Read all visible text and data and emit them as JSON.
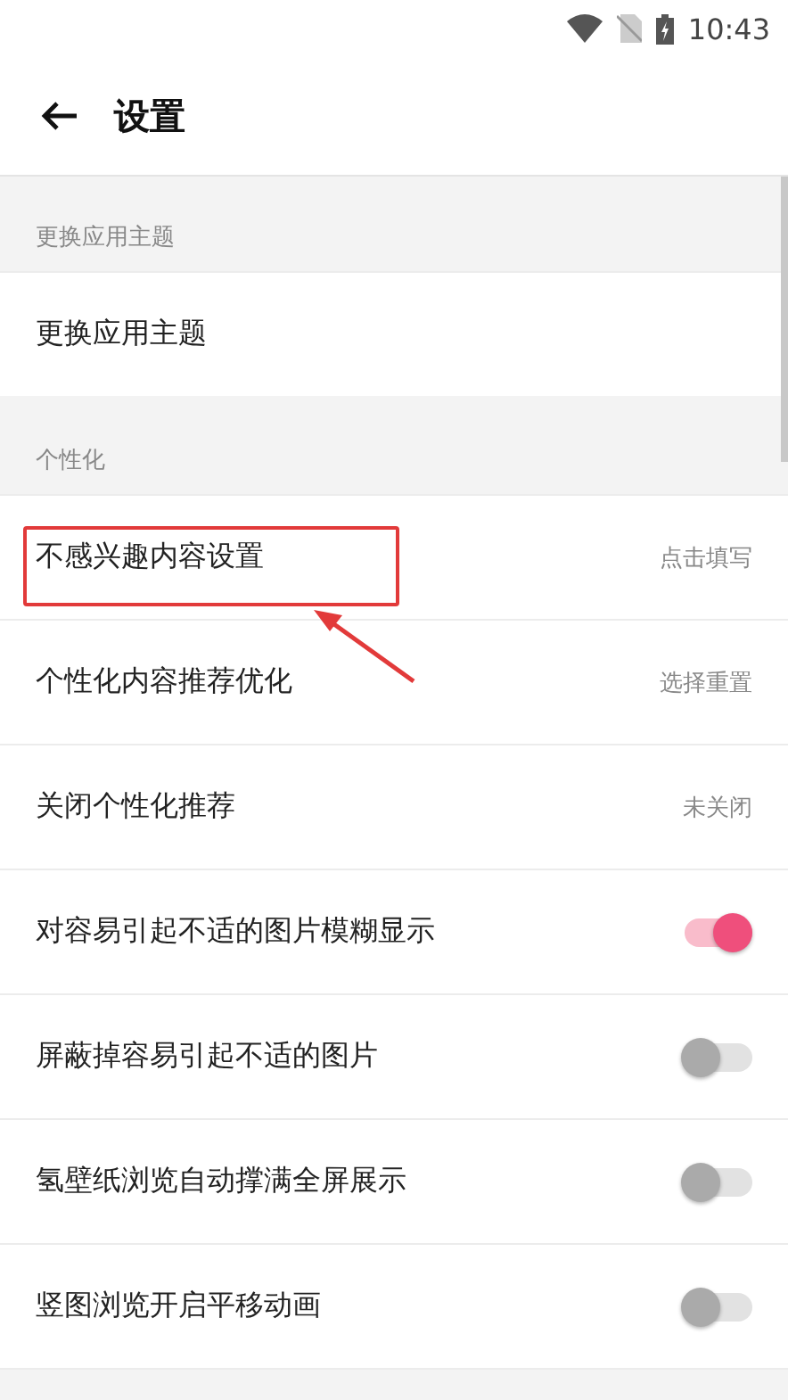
{
  "status_bar": {
    "time": "10:43"
  },
  "toolbar": {
    "title": "设置"
  },
  "sections": [
    {
      "header": "更换应用主题",
      "items": [
        {
          "kind": "value",
          "label": "更换应用主题",
          "highlighted": false
        }
      ]
    },
    {
      "header": "个性化",
      "items": [
        {
          "kind": "value",
          "label": "不感兴趣内容设置",
          "value": "点击填写",
          "highlighted": true
        },
        {
          "kind": "value",
          "label": "个性化内容推荐优化",
          "value": "选择重置",
          "highlighted": false
        },
        {
          "kind": "value",
          "label": "关闭个性化推荐",
          "value": "未关闭",
          "highlighted": false
        },
        {
          "kind": "toggle",
          "label": "对容易引起不适的图片模糊显示",
          "on": true,
          "highlighted": false
        },
        {
          "kind": "toggle",
          "label": "屏蔽掉容易引起不适的图片",
          "on": false,
          "highlighted": false
        },
        {
          "kind": "toggle",
          "label": "氢壁纸浏览自动撑满全屏展示",
          "on": false,
          "highlighted": false
        },
        {
          "kind": "toggle",
          "label": "竖图浏览开启平移动画",
          "on": false,
          "highlighted": false
        }
      ]
    }
  ]
}
